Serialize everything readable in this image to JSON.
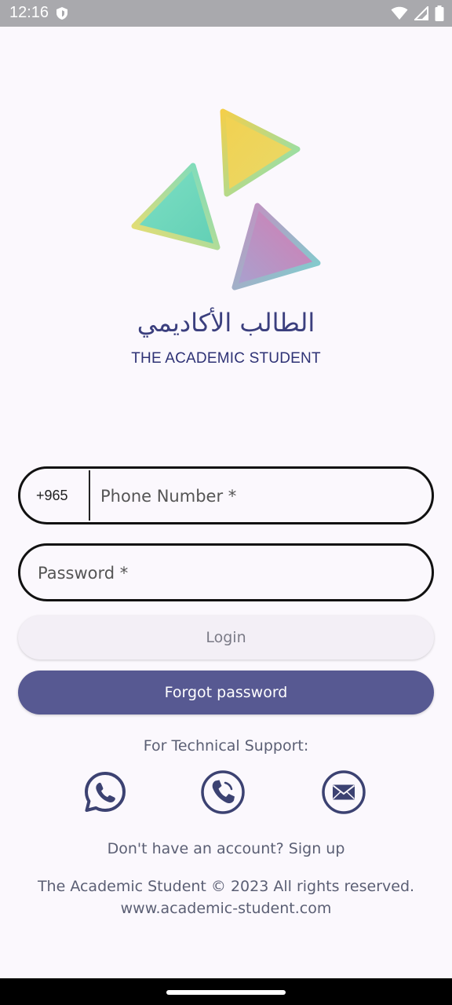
{
  "status_bar": {
    "time": "12:16",
    "icons": [
      "shield-icon",
      "wifi-icon",
      "signal-icon",
      "battery-icon"
    ]
  },
  "brand": {
    "arabic_name": "الطالب الأكاديمي",
    "english_name": "THE ACADEMIC STUDENT"
  },
  "login_form": {
    "country_code": "+965",
    "phone_placeholder": "Phone Number *",
    "password_placeholder": "Password *",
    "login_label": "Login",
    "forgot_label": "Forgot password"
  },
  "support": {
    "label": "For Technical Support:",
    "icons": [
      "whatsapp-icon",
      "phone-icon",
      "mail-icon"
    ]
  },
  "signup": {
    "text": "Don't have an account? Sign up"
  },
  "footer": {
    "copyright": "The Academic Student © 2023 All rights reserved.",
    "website": "www.academic-student.com"
  },
  "colors": {
    "primary": "#575992",
    "brand_text": "#3b3f7e",
    "background": "#fbf8fd",
    "status_bar": "#a9a9ad"
  }
}
